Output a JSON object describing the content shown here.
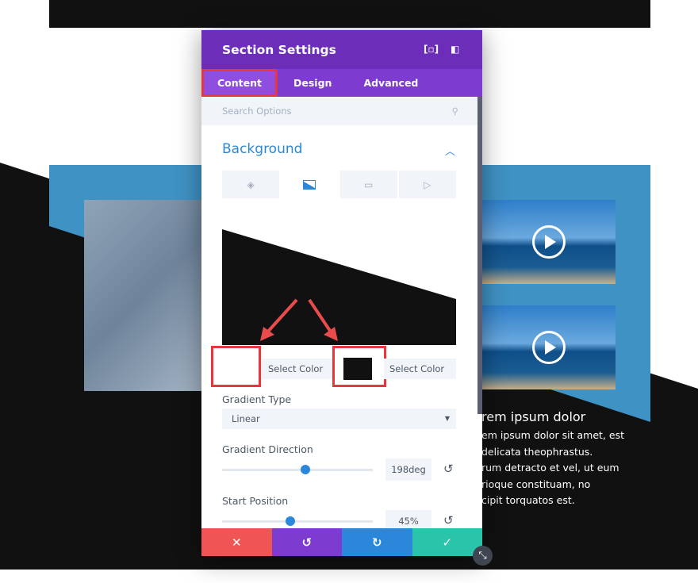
{
  "panel": {
    "title": "Section Settings",
    "tabs": [
      {
        "label": "Content"
      },
      {
        "label": "Design"
      },
      {
        "label": "Advanced"
      }
    ],
    "search_placeholder": "Search Options",
    "section_title": "Background",
    "color_stops": [
      {
        "label": "Select Color",
        "color": "#ffffff"
      },
      {
        "label": "Select Color",
        "color": "#111111"
      }
    ],
    "gradient_type": {
      "label": "Gradient Type",
      "value": "Linear"
    },
    "gradient_direction": {
      "label": "Gradient Direction",
      "value": "198deg",
      "fraction": 0.55
    },
    "start_position": {
      "label": "Start Position",
      "value": "45%",
      "fraction": 0.45
    }
  },
  "page_text": {
    "heading": "rem ipsum dolor",
    "lines": [
      "em ipsum dolor sit amet, est",
      "delicata theophrastus.",
      "rum detracto et vel, ut eum",
      "rioque constituam, no",
      "cipit torquatos est."
    ]
  },
  "colors": {
    "header": "#6c2eb9",
    "tabs": "#7e3bd0",
    "accent": "#2b87da",
    "cancel": "#ef5555",
    "undo": "#7e3bd0",
    "redo": "#2b87da",
    "save": "#29c4a9",
    "highlight": "#e8373c"
  }
}
